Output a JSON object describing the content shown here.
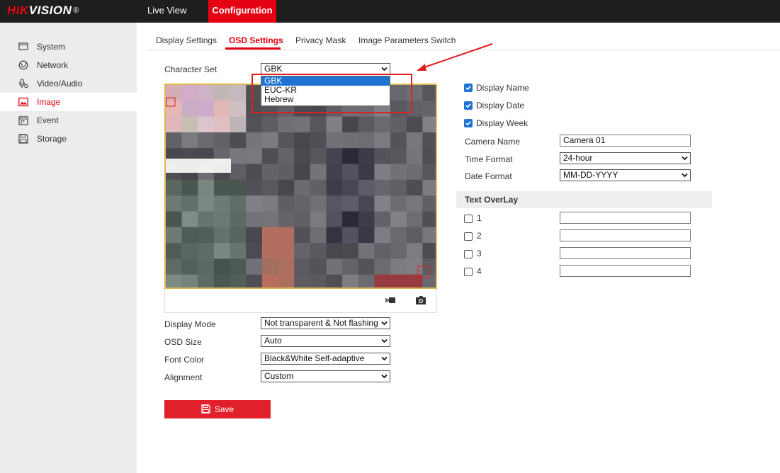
{
  "brand": {
    "part1": "HIK",
    "part2": "VISION",
    "mark": "®"
  },
  "topnav": {
    "live_view": "Live View",
    "configuration": "Configuration"
  },
  "sidebar": {
    "items": [
      {
        "label": "System",
        "icon": "monitor-icon"
      },
      {
        "label": "Network",
        "icon": "globe-icon"
      },
      {
        "label": "Video/Audio",
        "icon": "microphone-camera-icon"
      },
      {
        "label": "Image",
        "icon": "image-icon",
        "active": true
      },
      {
        "label": "Event",
        "icon": "calendar-icon"
      },
      {
        "label": "Storage",
        "icon": "floppy-disk-icon"
      }
    ]
  },
  "tabs": [
    {
      "label": "Display Settings"
    },
    {
      "label": "OSD Settings",
      "active": true
    },
    {
      "label": "Privacy Mask"
    },
    {
      "label": "Image Parameters Switch"
    }
  ],
  "character_set": {
    "label": "Character Set",
    "value": "GBK",
    "options": [
      "GBK",
      "EUC-KR",
      "Hebrew"
    ],
    "highlighted": "GBK"
  },
  "display_mode": {
    "label": "Display Mode",
    "value": "Not transparent & Not flashing"
  },
  "osd_size": {
    "label": "OSD Size",
    "value": "Auto"
  },
  "font_color": {
    "label": "Font Color",
    "value": "Black&White Self-adaptive"
  },
  "alignment": {
    "label": "Alignment",
    "value": "Custom"
  },
  "display_options": [
    {
      "label": "Display Name",
      "checked": true
    },
    {
      "label": "Display Date",
      "checked": true
    },
    {
      "label": "Display Week",
      "checked": true
    }
  ],
  "camera_name": {
    "label": "Camera Name",
    "value": "Camera 01"
  },
  "time_format": {
    "label": "Time Format",
    "value": "24-hour"
  },
  "date_format": {
    "label": "Date Format",
    "value": "MM-DD-YYYY"
  },
  "text_overlay": {
    "title": "Text OverLay",
    "rows": [
      {
        "label": "1",
        "checked": false,
        "value": ""
      },
      {
        "label": "2",
        "checked": false,
        "value": ""
      },
      {
        "label": "3",
        "checked": false,
        "value": ""
      },
      {
        "label": "4",
        "checked": false,
        "value": ""
      }
    ]
  },
  "save": {
    "label": "Save"
  },
  "colors": {
    "accent": "#e50012",
    "topbar": "#1e1e1e",
    "sidebar": "#ececec",
    "selection": "#1e73d2",
    "annotation": "#e02020"
  }
}
